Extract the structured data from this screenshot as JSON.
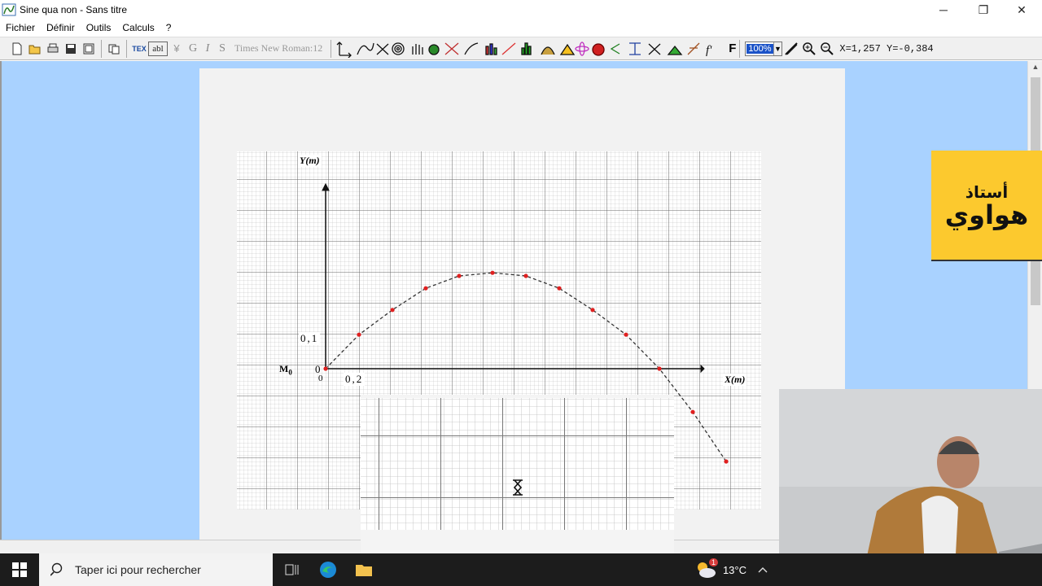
{
  "window": {
    "title": "Sine qua non - Sans titre",
    "minimize": "─",
    "restore": "❐",
    "close": "✕"
  },
  "menu": {
    "items": [
      "Fichier",
      "Définir",
      "Outils",
      "Calculs",
      "?"
    ]
  },
  "toolbar": {
    "bold": "G",
    "italic": "I",
    "strike": "S",
    "font": "Times New Roman:12",
    "tex": "TEX",
    "text_tool": "abl",
    "f_prime": "f'",
    "f_label": "F",
    "zoom": "100%",
    "coords": "X=1,257  Y=-0,384",
    "icons": [
      "new-file-icon",
      "open-folder-icon",
      "print-icon",
      "save-icon",
      "save-as-icon",
      "copy-icon",
      "axes-icon",
      "curve-icon",
      "intersect-icon",
      "spiral-icon",
      "hand-icon",
      "sphere-icon",
      "tangent-icon",
      "function-icon",
      "bar-chart-icon",
      "segment-icon",
      "histogram-icon",
      "distribution-icon",
      "triangle-icon",
      "atom-icon",
      "apple-icon",
      "angle-icon",
      "vector-icon",
      "cross-icon",
      "gauge-icon",
      "pattern-icon",
      "zoom-in-icon",
      "zoom-out-icon",
      "magnifier-icon"
    ]
  },
  "graph": {
    "y_axis_label": "Y(m)",
    "x_axis_label": "X(m)",
    "y_tick": "0,1",
    "x_tick": "0,2",
    "origin_y": "0",
    "origin_x": "0",
    "origin_point": "M",
    "origin_point_sub": "0",
    "points_x": [
      0,
      0.2,
      0.4,
      0.6,
      0.8,
      1.0,
      1.2,
      1.4,
      1.6,
      1.8,
      2.0,
      2.2,
      2.4
    ],
    "points_y": [
      0,
      0.11,
      0.19,
      0.26,
      0.3,
      0.31,
      0.3,
      0.26,
      0.19,
      0.11,
      0,
      -0.14,
      -0.3
    ],
    "point_color": "#e02020"
  },
  "logo": {
    "line1": "أستاذ",
    "line2": "هواوي"
  },
  "taskbar": {
    "search_placeholder": "Taper ici pour rechercher",
    "temperature": "13°C",
    "notification_count": "1"
  },
  "colors": {
    "workspace": "#a9d2ff",
    "logo_bg": "#fcc92e",
    "taskbar": "#1c1c1c"
  }
}
